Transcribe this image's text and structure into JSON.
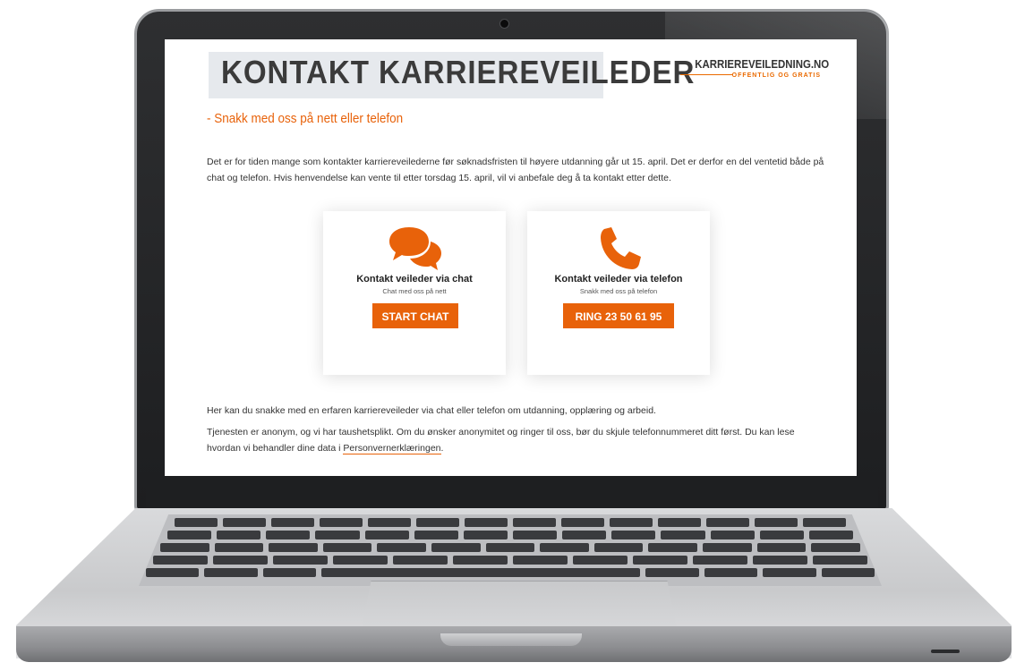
{
  "page": {
    "title": "KONTAKT KARRIEREVEILEDER",
    "subtitle": "- Snakk med oss på nett eller telefon",
    "brand": {
      "name": "KARRIEREVEILEDNING.NO",
      "tagline": "OFFENTLIG OG GRATIS"
    },
    "intro": "Det er for tiden mange som kontakter karriereveilederne før søknadsfristen til høyere utdanning går ut 15. april. Det er derfor en del ventetid både på chat og telefon. Hvis henvendelse kan vente til etter torsdag 15. april, vil vi anbefale deg å ta kontakt etter dette.",
    "cards": {
      "chat": {
        "icon": "chat-bubbles-icon",
        "title": "Kontakt veileder via chat",
        "subtitle": "Chat med oss på nett",
        "button": "START CHAT"
      },
      "phone": {
        "icon": "phone-icon",
        "title": "Kontakt veileder via telefon",
        "subtitle": "Snakk med oss på telefon",
        "button": "RING 23 50 61 95"
      }
    },
    "para1": "Her kan du snakke med en erfaren karriereveileder via chat eller telefon om utdanning, opplæring og arbeid.",
    "para2_text": "Tjenesten er anonym, og vi har taushetsplikt. Om du ønsker anonymitet og ringer til oss, bør du skjule telefonnummeret ditt først. Du kan lese hvordan vi behandler dine data i ",
    "para2_link": "Personvernerklæringen",
    "para2_end": "."
  },
  "colors": {
    "accent": "#e8620a",
    "header_bg": "#e6e9ed",
    "text": "#333333"
  }
}
